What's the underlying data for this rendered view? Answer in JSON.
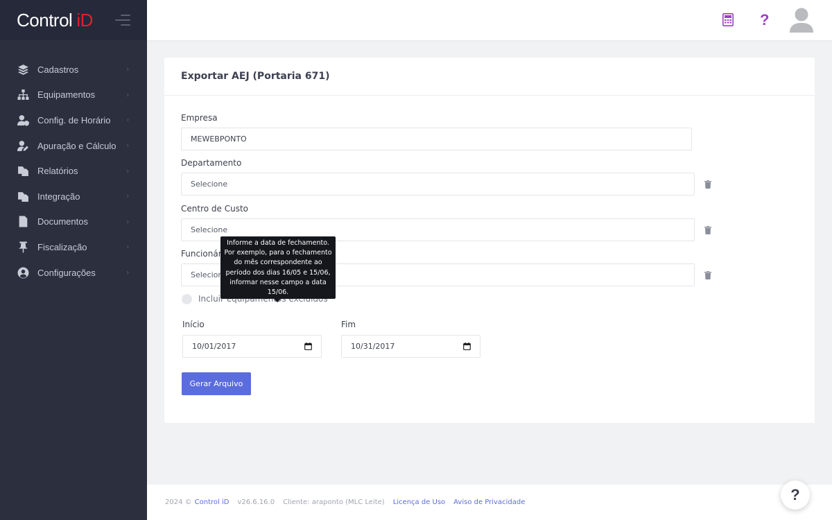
{
  "brand": {
    "name_part1": "Control",
    "name_part2": "iD"
  },
  "sidebar": {
    "items": [
      {
        "label": "Cadastros",
        "icon": "layers-icon"
      },
      {
        "label": "Equipamentos",
        "icon": "sitemap-icon"
      },
      {
        "label": "Config. de Horário",
        "icon": "user-clock-icon"
      },
      {
        "label": "Apuração e Cálculo",
        "icon": "user-edit-icon"
      },
      {
        "label": "Relatórios",
        "icon": "copy-icon"
      },
      {
        "label": "Integração",
        "icon": "copy-icon"
      },
      {
        "label": "Documentos",
        "icon": "file-icon"
      },
      {
        "label": "Fiscalização",
        "icon": "pin-icon"
      },
      {
        "label": "Configurações",
        "icon": "user-circle-icon"
      }
    ]
  },
  "topbar": {
    "help_glyph": "?"
  },
  "form": {
    "title": "Exportar AEJ (Portaria 671)",
    "empresa": {
      "label": "Empresa",
      "value": "MEWEBPONTO"
    },
    "departamento": {
      "label": "Departamento",
      "placeholder": "Selecione"
    },
    "centro_custo": {
      "label": "Centro de Custo",
      "placeholder": "Selecione"
    },
    "funcionario": {
      "label": "Funcionário",
      "placeholder": "Selecione"
    },
    "incluir_excluidos": {
      "label": "Incluir equipamentos excluídos"
    },
    "inicio": {
      "label": "Início",
      "value": "10/01/2017"
    },
    "fim": {
      "label": "Fim",
      "value": "10/31/2017"
    },
    "submit_label": "Gerar Arquivo"
  },
  "tooltip": {
    "lines": [
      "Informe a data de fechamento.",
      "Por exemplo, para o fechamento",
      "do mês correspondente ao",
      "período dos dias 16/05 e 15/06,",
      "informar nesse campo a data",
      "15/06."
    ]
  },
  "footer": {
    "year": "2024 ©",
    "brand_link": "Control iD",
    "version": "v26.6.16.0",
    "cliente": "Cliente: araponto (MLC Leite)",
    "licenca_link": "Licença de Uso",
    "privacidade_link": "Aviso de Privacidade"
  },
  "help_fab": "?",
  "colors": {
    "sidebar_bg": "#2b2f3e",
    "accent": "#5b6ddc",
    "brand_red": "#e31e2d",
    "help_purple": "#9b3fc8"
  }
}
